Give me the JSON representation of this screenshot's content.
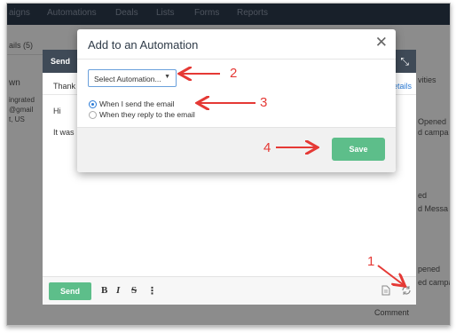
{
  "nav": {
    "items": [
      "aigns",
      "Automations",
      "Deals",
      "Lists",
      "Forms",
      "Reports"
    ]
  },
  "background": {
    "left_texts": [
      "ails (5)",
      "wn",
      "ingrated",
      "@gmail",
      "t, US"
    ],
    "right_texts": [
      "vities",
      "Opened",
      "d campa",
      "ed",
      "d Messa",
      "pened",
      "ed campa",
      "Comment"
    ]
  },
  "compose": {
    "header_title": "Send",
    "subject_partial": "Thank",
    "details_link": "etails",
    "greeting": "Hi",
    "body_partial": "It was",
    "send_label": "Send",
    "bold_label": "B",
    "italic_label": "I",
    "strike_label": "S",
    "more_label": "⋮",
    "expand_icon": "⤡"
  },
  "modal": {
    "title": "Add to an Automation",
    "close_icon": "✕",
    "select_value": "Select Automation...",
    "options": [
      {
        "label": "When I send the email",
        "selected": true
      },
      {
        "label": "When they reply to the email",
        "selected": false
      }
    ],
    "save_label": "Save"
  },
  "annotations": [
    "1",
    "2",
    "3",
    "4"
  ],
  "colors": {
    "accent_green": "#5dbe8a",
    "link_blue": "#2b7bd6",
    "annotation_red": "#e53935",
    "nav_dark": "#2d3b4e"
  }
}
